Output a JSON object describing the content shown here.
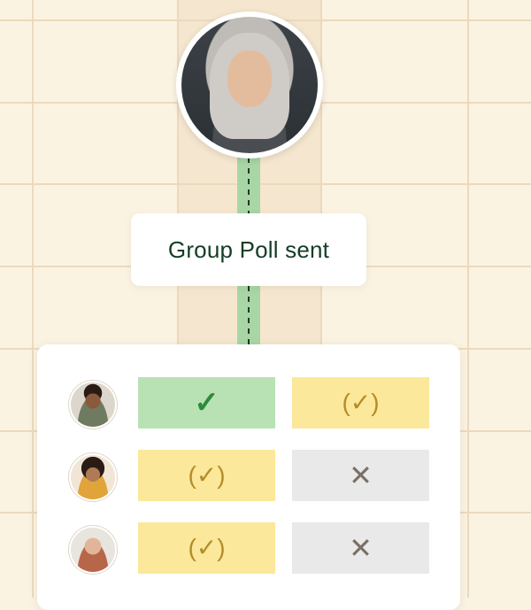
{
  "callout": {
    "text": "Group Poll sent"
  },
  "organizer": {
    "avatar": "organizer-avatar"
  },
  "poll": {
    "rows": [
      {
        "avatar": "participant-1-avatar",
        "votes": [
          "yes",
          "maybe"
        ]
      },
      {
        "avatar": "participant-2-avatar",
        "votes": [
          "maybe",
          "no"
        ]
      },
      {
        "avatar": "participant-3-avatar",
        "votes": [
          "maybe",
          "no"
        ]
      }
    ],
    "symbols": {
      "yes": "✓",
      "maybe": "(✓)",
      "no": "✕"
    }
  },
  "colors": {
    "background": "#fbf3e2",
    "grid_line": "#ecd9bd",
    "connector": "#a8d6a4",
    "yes": "#b9e2b4",
    "maybe": "#fbe89a",
    "no": "#e9e9e9",
    "title_text": "#143d25"
  }
}
